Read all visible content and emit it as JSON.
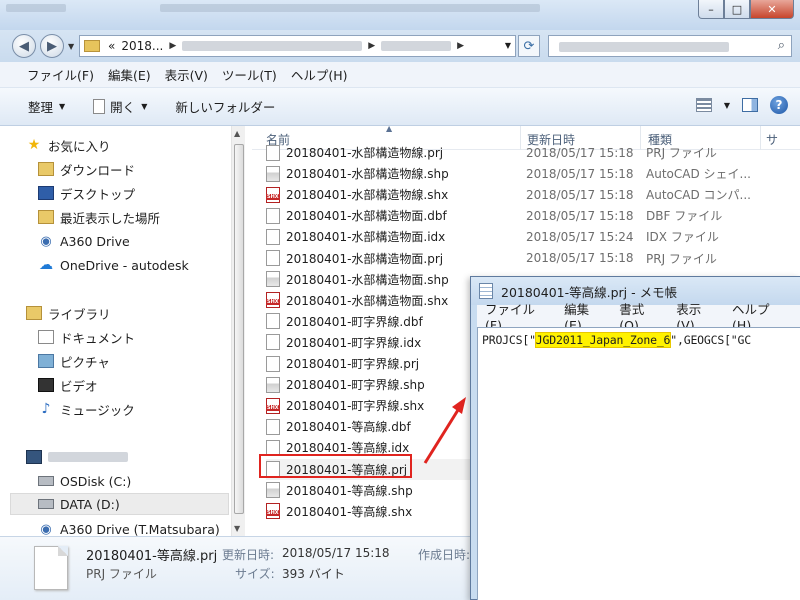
{
  "explorer": {
    "address": {
      "chevrons": "«",
      "path_start": "2018..."
    },
    "menu": [
      "ファイル(F)",
      "編集(E)",
      "表示(V)",
      "ツール(T)",
      "ヘルプ(H)"
    ],
    "toolbar": {
      "organize": "整理",
      "open": "開く",
      "new_folder": "新しいフォルダー"
    },
    "sidebar": {
      "favorites": "お気に入り",
      "downloads": "ダウンロード",
      "desktop": "デスクトップ",
      "recent": "最近表示した場所",
      "a360": "A360 Drive",
      "onedrive": "OneDrive - autodesk",
      "libraries": "ライブラリ",
      "documents": "ドキュメント",
      "pictures": "ピクチャ",
      "videos": "ビデオ",
      "music": "ミュージック",
      "osdisk": "OSDisk (C:)",
      "data_drive": "DATA (D:)",
      "a360_user": "A360 Drive (T.Matsubara)"
    },
    "columns": {
      "name": "名前",
      "date": "更新日時",
      "type": "種類",
      "extra": "サ"
    },
    "files": [
      {
        "name": "20180401-水部構造物線.prj",
        "date": "2018/05/17 15:18",
        "type": "PRJ ファイル",
        "kind": "prj"
      },
      {
        "name": "20180401-水部構造物線.shp",
        "date": "2018/05/17 15:18",
        "type": "AutoCAD シェイ...",
        "kind": "shp"
      },
      {
        "name": "20180401-水部構造物線.shx",
        "date": "2018/05/17 15:18",
        "type": "AutoCAD コンパ...",
        "kind": "shx"
      },
      {
        "name": "20180401-水部構造物面.dbf",
        "date": "2018/05/17 15:18",
        "type": "DBF ファイル",
        "kind": "dbf"
      },
      {
        "name": "20180401-水部構造物面.idx",
        "date": "2018/05/17 15:24",
        "type": "IDX ファイル",
        "kind": "idx"
      },
      {
        "name": "20180401-水部構造物面.prj",
        "date": "2018/05/17 15:18",
        "type": "PRJ ファイル",
        "kind": "prj"
      },
      {
        "name": "20180401-水部構造物面.shp",
        "date": "",
        "type": "",
        "kind": "shp"
      },
      {
        "name": "20180401-水部構造物面.shx",
        "date": "",
        "type": "",
        "kind": "shx"
      },
      {
        "name": "20180401-町字界線.dbf",
        "date": "",
        "type": "",
        "kind": "dbf"
      },
      {
        "name": "20180401-町字界線.idx",
        "date": "",
        "type": "",
        "kind": "idx"
      },
      {
        "name": "20180401-町字界線.prj",
        "date": "",
        "type": "",
        "kind": "prj"
      },
      {
        "name": "20180401-町字界線.shp",
        "date": "",
        "type": "",
        "kind": "shp"
      },
      {
        "name": "20180401-町字界線.shx",
        "date": "",
        "type": "",
        "kind": "shx"
      },
      {
        "name": "20180401-等高線.dbf",
        "date": "",
        "type": "",
        "kind": "dbf"
      },
      {
        "name": "20180401-等高線.idx",
        "date": "",
        "type": "",
        "kind": "idx"
      },
      {
        "name": "20180401-等高線.prj",
        "date": "",
        "type": "",
        "kind": "prj"
      },
      {
        "name": "20180401-等高線.shp",
        "date": "",
        "type": "",
        "kind": "shp"
      },
      {
        "name": "20180401-等高線.shx",
        "date": "",
        "type": "",
        "kind": "shx"
      }
    ],
    "details": {
      "name": "20180401-等高線.prj",
      "type": "PRJ ファイル",
      "modified_label": "更新日時:",
      "modified_value": "2018/05/17 15:18",
      "size_label": "サイズ:",
      "size_value": "393 バイト",
      "created_label": "作成日時:"
    }
  },
  "notepad": {
    "title": "20180401-等高線.prj - メモ帳",
    "menu": [
      "ファイル(F)",
      "編集(E)",
      "書式(O)",
      "表示(V)",
      "ヘルプ(H)"
    ],
    "content_prefix": "PROJCS[\"",
    "content_highlight": "JGD2011_Japan_Zone_6",
    "content_suffix": "\",GEOGCS[\"GC"
  },
  "colors": {
    "highlight": "#fff200",
    "annotation_red": "#e0241f",
    "title_gradient": "#c3d7ee"
  },
  "icons": [
    "back-arrow-icon",
    "forward-arrow-icon",
    "folder-icon",
    "refresh-icon",
    "search-icon",
    "star-icon",
    "cloud-icon",
    "help-icon"
  ]
}
